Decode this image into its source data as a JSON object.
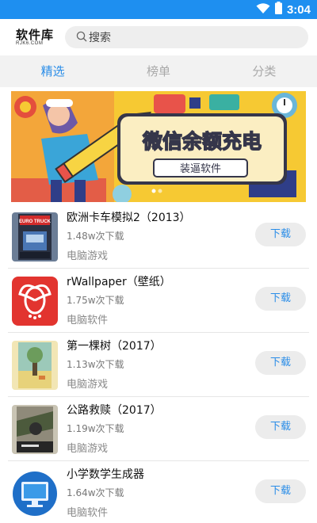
{
  "status_bar": {
    "time": "3:04",
    "colors": {
      "background": "#1e8ff0",
      "foreground": "#ffffff"
    },
    "icons": [
      "wifi-icon",
      "battery-icon"
    ]
  },
  "header": {
    "logo_main": "软件库",
    "logo_sub": "RJK6.COM",
    "search_placeholder": "搜索"
  },
  "tabs": [
    {
      "label": "精选",
      "active": true
    },
    {
      "label": "榜单",
      "active": false
    },
    {
      "label": "分类",
      "active": false
    }
  ],
  "banner": {
    "headline": "微信余额充电",
    "subline": "装逼软件"
  },
  "apps": [
    {
      "name": "欧洲卡车模拟2（2013）",
      "downloads": "1.48w次下载",
      "category": "电脑游戏",
      "button": "下载",
      "icon": "euro-truck-icon"
    },
    {
      "name": "rWallpaper（壁纸）",
      "downloads": "1.75w次下载",
      "category": "电脑软件",
      "button": "下载",
      "icon": "wallpaper-app-icon"
    },
    {
      "name": "第一棵树（2017）",
      "downloads": "1.13w次下载",
      "category": "电脑游戏",
      "button": "下载",
      "icon": "first-tree-icon"
    },
    {
      "name": "公路救赎（2017）",
      "downloads": "1.19w次下载",
      "category": "电脑游戏",
      "button": "下载",
      "icon": "road-redemption-icon"
    },
    {
      "name": "小学数学生成器",
      "downloads": "1.64w次下载",
      "category": "电脑软件",
      "button": "下载",
      "icon": "monitor-icon"
    }
  ],
  "colors": {
    "accent": "#2a8de8",
    "tab_bar": "#f2f2f2",
    "button_bg": "#ececec"
  }
}
